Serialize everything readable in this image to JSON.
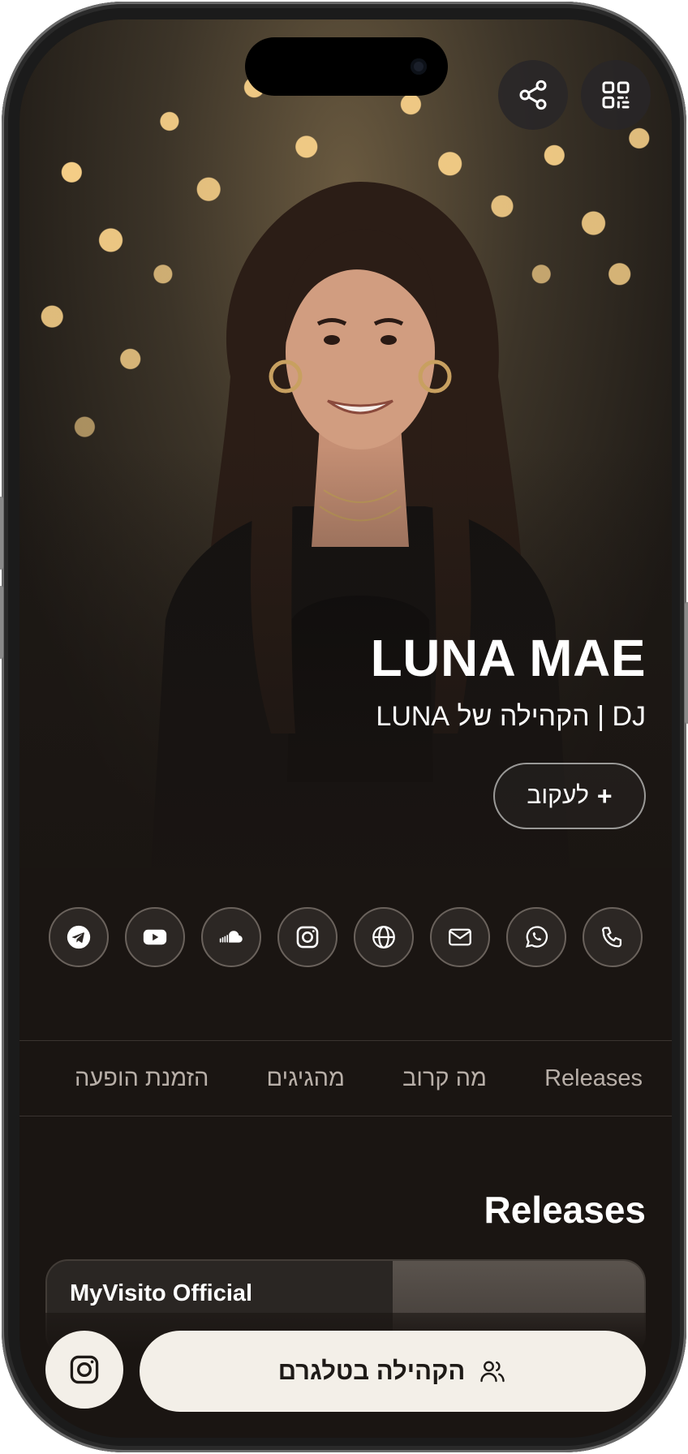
{
  "profile": {
    "name": "LUNA MAE",
    "tagline": "DJ | הקהילה של LUNA",
    "follow_label": "לעקוב",
    "follow_plus": "+"
  },
  "top_actions": {
    "share_icon": "share-icon",
    "qr_icon": "qr-code-icon"
  },
  "social_icons": [
    "phone-icon",
    "whatsapp-icon",
    "mail-icon",
    "globe-icon",
    "instagram-icon",
    "soundcloud-icon",
    "youtube-icon",
    "telegram-icon"
  ],
  "tabs": [
    {
      "label": "Releases"
    },
    {
      "label": "מה קרוב"
    },
    {
      "label": "מהגיגים"
    },
    {
      "label": "הזמנת הופעה"
    }
  ],
  "releases": {
    "section_title": "Releases",
    "items": [
      {
        "title": "MyVisito Official"
      }
    ]
  },
  "bottom": {
    "cta_label": "הקהילה בטלגרם",
    "cta_icon": "users-icon",
    "instagram_icon": "instagram-icon"
  },
  "colors": {
    "background": "#1a1512",
    "button_light": "#f3efe8",
    "accent_text": "#ffffff"
  }
}
